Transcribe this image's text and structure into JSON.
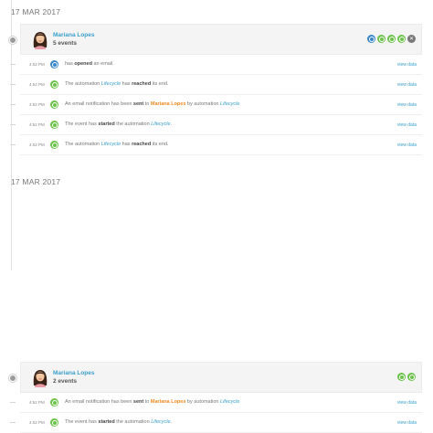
{
  "days": [
    {
      "date": "17 MAR 2017",
      "contact": {
        "name": "Mariana Lopes",
        "count_label": "5 events"
      },
      "header_badges": [
        "blue",
        "green",
        "green",
        "green",
        "grey"
      ],
      "events": [
        {
          "time": "4:52 PM",
          "icon": "blue",
          "parts": [
            [
              "has ",
              ""
            ],
            [
              "opened",
              "b"
            ],
            [
              " an email.",
              ""
            ]
          ],
          "link": "view data"
        },
        {
          "time": "4:52 PM",
          "icon": "green",
          "parts": [
            [
              "The automation ",
              ""
            ],
            [
              "Lifecycle",
              "blue"
            ],
            [
              " has ",
              ""
            ],
            [
              "reached",
              "b"
            ],
            [
              " its end.",
              ""
            ]
          ],
          "link": "view data"
        },
        {
          "time": "4:52 PM",
          "icon": "green",
          "parts": [
            [
              "An email notification has been ",
              ""
            ],
            [
              "sent",
              "b"
            ],
            [
              " to ",
              ""
            ],
            [
              "Mariana Lopes",
              "orange"
            ],
            [
              " by automation ",
              ""
            ],
            [
              "Lifecycle",
              "blue"
            ]
          ],
          "link": "view data"
        },
        {
          "time": "4:52 PM",
          "icon": "green",
          "parts": [
            [
              "The event has ",
              ""
            ],
            [
              "started",
              "b"
            ],
            [
              " the automation ",
              ""
            ],
            [
              "Lifecycle",
              "blue"
            ],
            [
              ".",
              ""
            ]
          ],
          "link": "view data"
        },
        {
          "time": "4:52 PM",
          "icon": "green",
          "parts": [
            [
              "The automation ",
              ""
            ],
            [
              "Lifecycle",
              "blue"
            ],
            [
              " has ",
              ""
            ],
            [
              "reached",
              "b"
            ],
            [
              " its end.",
              ""
            ]
          ],
          "link": "view data"
        }
      ]
    },
    {
      "date": "17 MAR 2017",
      "contact": {
        "name": "Mariana Lopes",
        "count_label": "2 events"
      },
      "header_badges": [
        "green",
        "green"
      ],
      "events": [
        {
          "time": "4:52 PM",
          "icon": "green",
          "parts": [
            [
              "An email notification has been ",
              ""
            ],
            [
              "sent",
              "b"
            ],
            [
              " to ",
              ""
            ],
            [
              "Mariana Lopes",
              "orange"
            ],
            [
              " by automation ",
              ""
            ],
            [
              "Lifecycle",
              "blue"
            ]
          ],
          "link": "view data"
        },
        {
          "time": "4:52 PM",
          "icon": "green",
          "parts": [
            [
              "The event has ",
              ""
            ],
            [
              "started",
              "b"
            ],
            [
              " the automation ",
              ""
            ],
            [
              "Lifecycle",
              "blue"
            ],
            [
              ".",
              ""
            ]
          ],
          "link": "view data"
        }
      ]
    }
  ],
  "colors": {
    "link": "#3aa0c9",
    "accent_orange": "#f08a24",
    "badge_blue": "#3a86c9",
    "badge_green": "#6cc24a",
    "badge_grey": "#777777"
  },
  "icons": {
    "opened": "circle-icon",
    "automation": "circle-icon",
    "close": "close-icon"
  }
}
